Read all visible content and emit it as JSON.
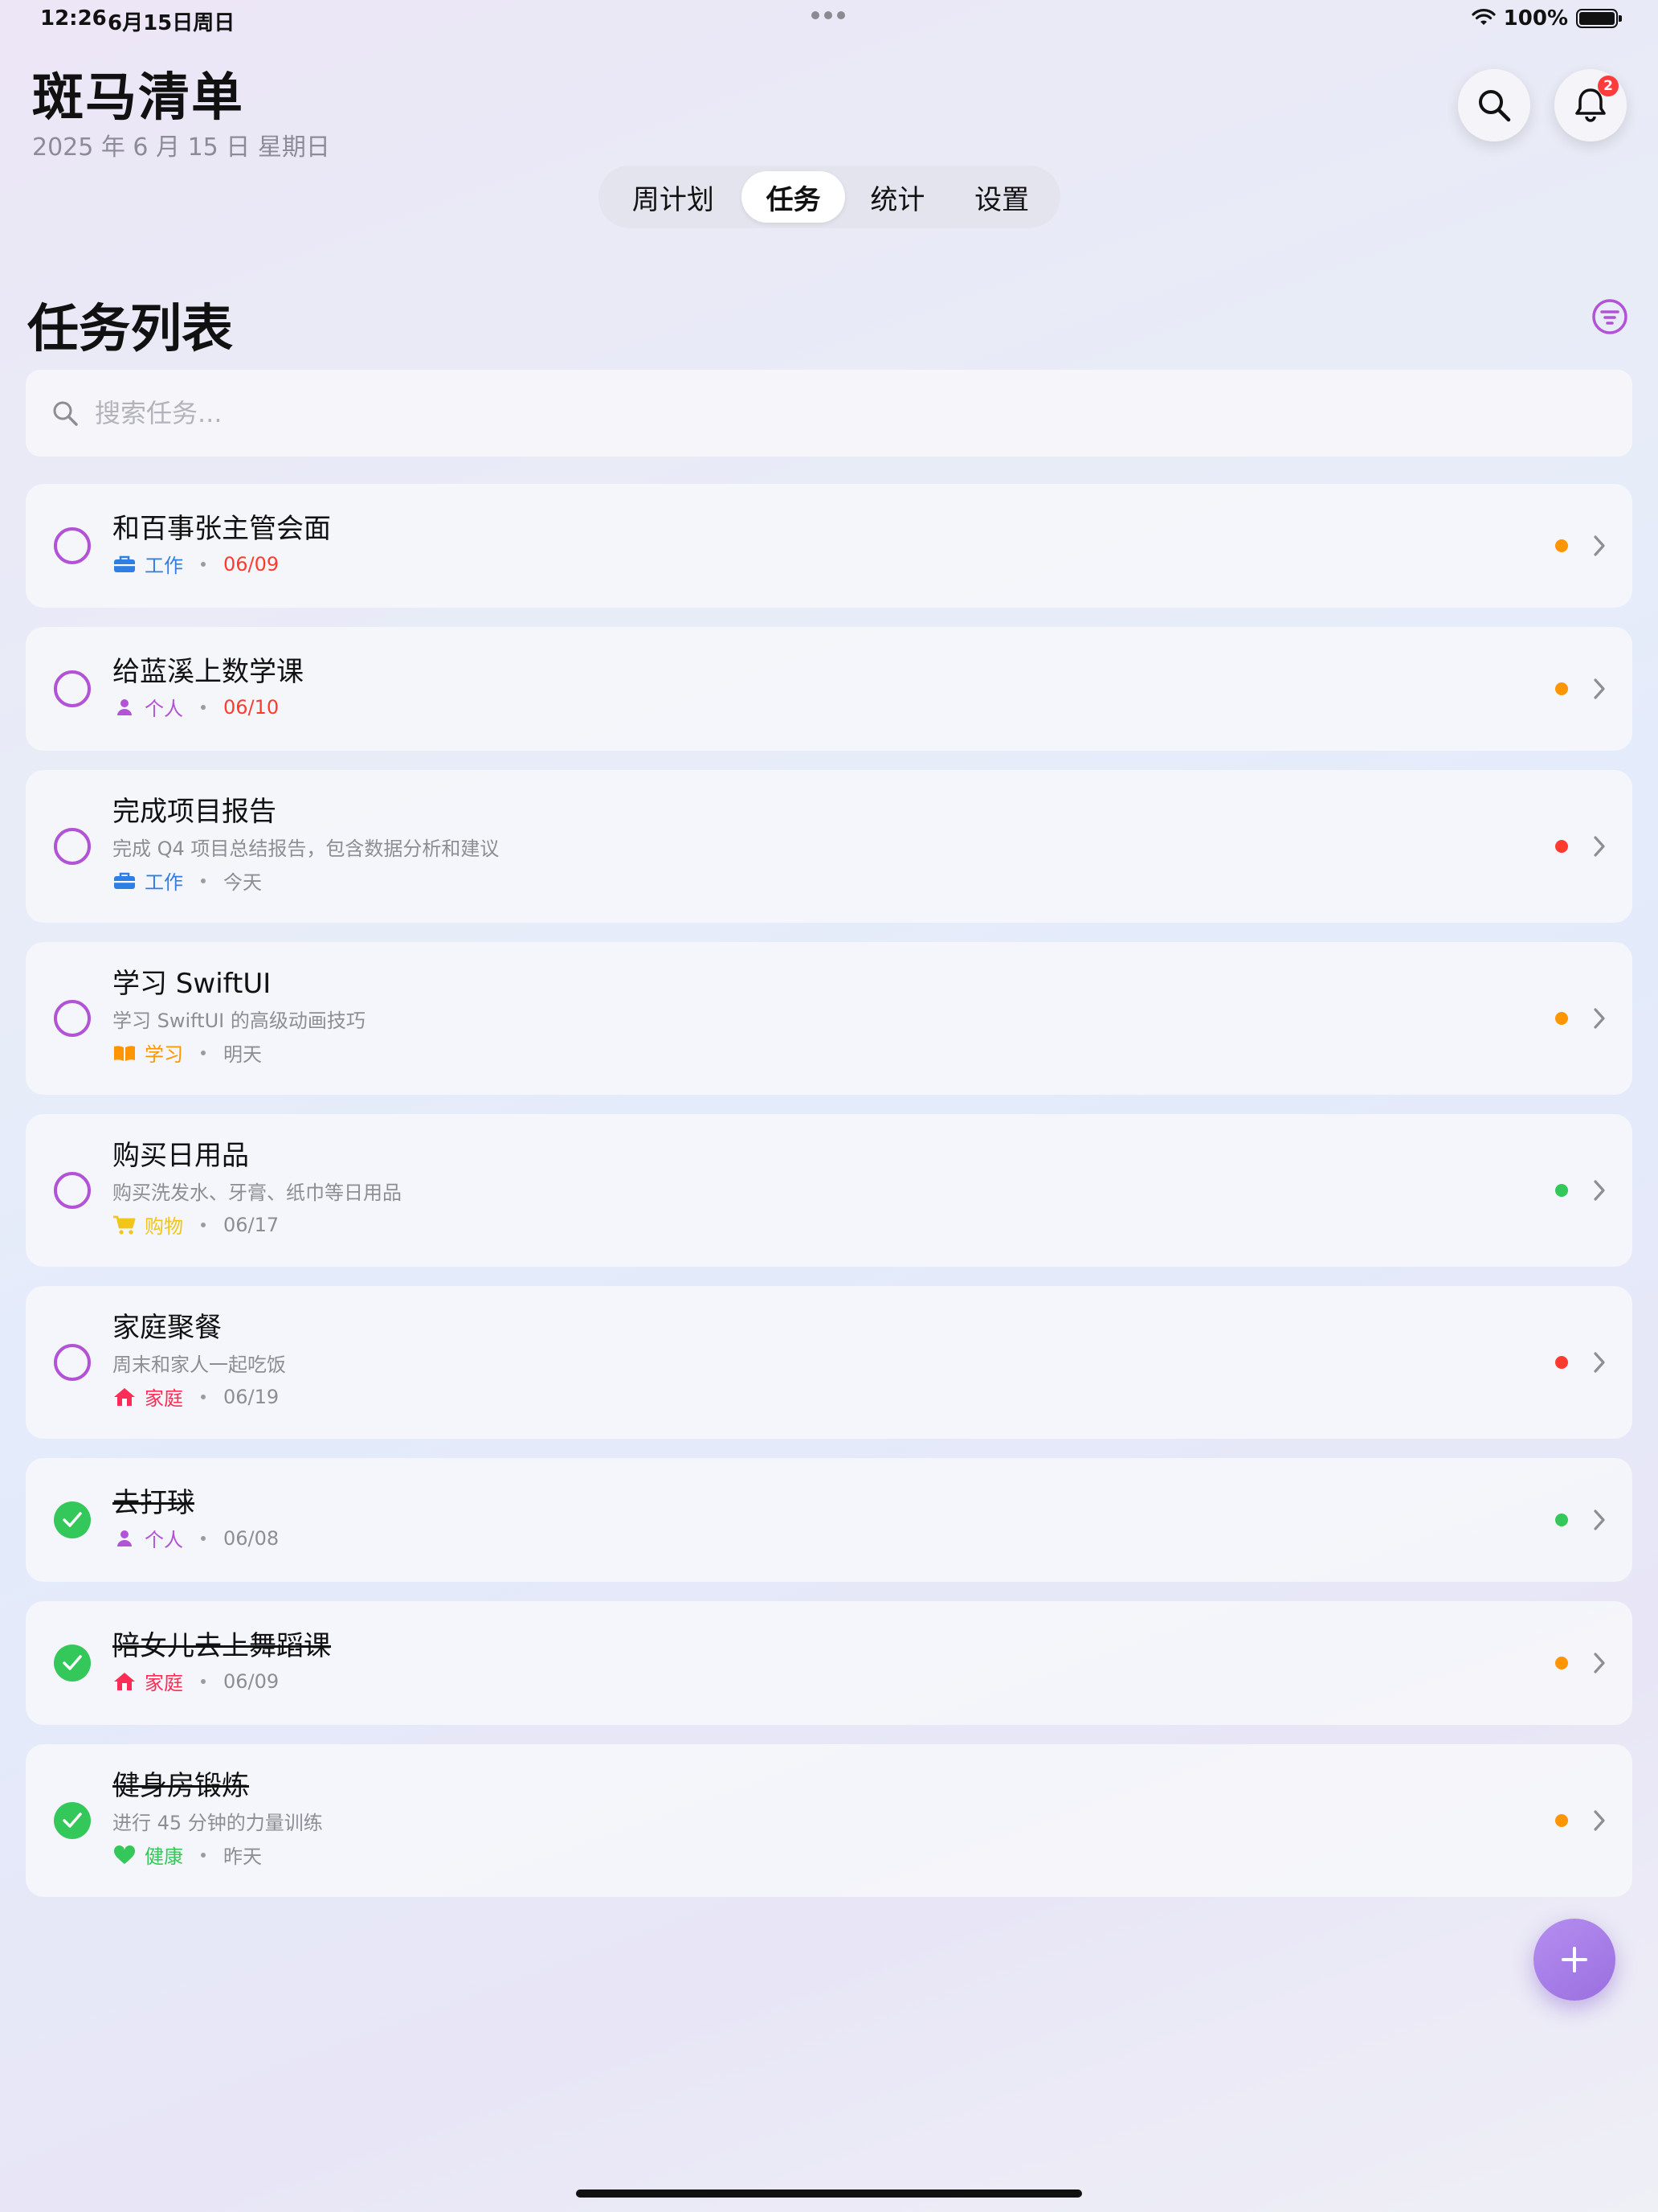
{
  "status_bar": {
    "time": "12:26",
    "date": "6月15日周日",
    "battery": "100%"
  },
  "header": {
    "title": "斑马清单",
    "date": "2025 年 6 月 15 日 星期日",
    "notification_count": "2"
  },
  "tabs": [
    {
      "label": "周计划",
      "active": false
    },
    {
      "label": "任务",
      "active": true
    },
    {
      "label": "统计",
      "active": false
    },
    {
      "label": "设置",
      "active": false
    }
  ],
  "list_title": "任务列表",
  "search": {
    "placeholder": "搜索任务..."
  },
  "colors": {
    "accent": "#b252d6",
    "done": "#34c759",
    "priority_high": "#ff3b30",
    "priority_medium": "#ff9500",
    "priority_low": "#34c759",
    "work": "#2f7ee6",
    "personal": "#b252d6",
    "study": "#ff9500",
    "shopping": "#f2c516",
    "family": "#ff2d55",
    "health": "#34c759",
    "overdue": "#ff3b30"
  },
  "tasks": [
    {
      "title": "和百事张主管会面",
      "description": "",
      "category": "工作",
      "category_icon": "briefcase-icon",
      "due": "06/09",
      "priority": "medium",
      "done": false
    },
    {
      "title": "给蓝溪上数学课",
      "description": "",
      "category": "个人",
      "category_icon": "person-icon",
      "due": "06/10",
      "priority": "medium",
      "done": false
    },
    {
      "title": "完成项目报告",
      "description": "完成 Q4 项目总结报告，包含数据分析和建议",
      "category": "工作",
      "category_icon": "briefcase-icon",
      "due": "今天",
      "priority": "high",
      "done": false
    },
    {
      "title": "学习 SwiftUI",
      "description": "学习 SwiftUI 的高级动画技巧",
      "category": "学习",
      "category_icon": "book-icon",
      "due": "明天",
      "priority": "medium",
      "done": false
    },
    {
      "title": "购买日用品",
      "description": "购买洗发水、牙膏、纸巾等日用品",
      "category": "购物",
      "category_icon": "cart-icon",
      "due": "06/17",
      "priority": "low",
      "done": false
    },
    {
      "title": "家庭聚餐",
      "description": "周末和家人一起吃饭",
      "category": "家庭",
      "category_icon": "house-icon",
      "due": "06/19",
      "priority": "high",
      "done": false
    },
    {
      "title": "去打球",
      "description": "",
      "category": "个人",
      "category_icon": "person-icon",
      "due": "06/08",
      "priority": "low",
      "done": true
    },
    {
      "title": "陪女儿去上舞蹈课",
      "description": "",
      "category": "家庭",
      "category_icon": "house-icon",
      "due": "06/09",
      "priority": "medium",
      "done": true
    },
    {
      "title": "健身房锻炼",
      "description": "进行 45 分钟的力量训练",
      "category": "健康",
      "category_icon": "heart-icon",
      "due": "昨天",
      "priority": "medium",
      "done": true
    }
  ]
}
